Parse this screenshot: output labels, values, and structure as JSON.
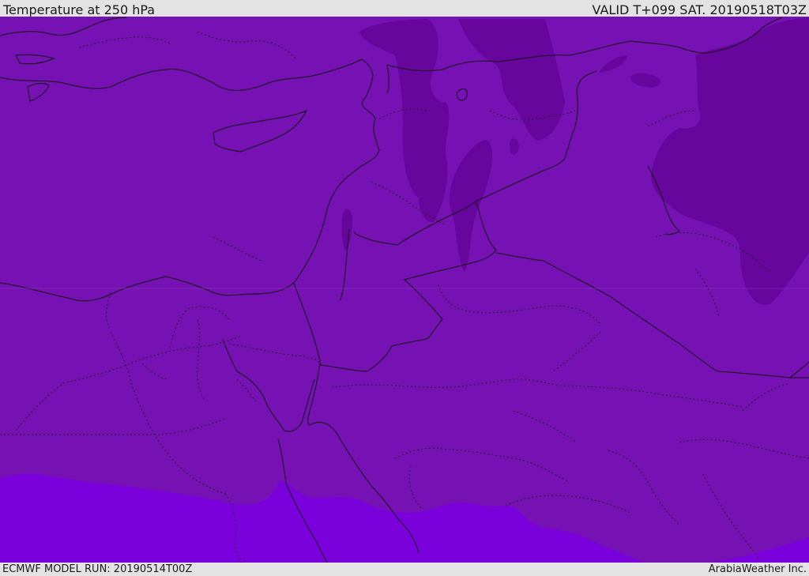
{
  "header": {
    "title": "Temperature at 250 hPa",
    "valid": "VALID T+099 SAT. 20190518T03Z"
  },
  "footer": {
    "model_run": "ECMWF MODEL RUN: 20190514T00Z",
    "credit": "ArabiaWeather Inc."
  },
  "map": {
    "field": "temperature",
    "level": "250 hPa",
    "colors": {
      "base": "#7612b4",
      "darker": "#66069c",
      "warm_band": "#7a00dc",
      "land_border": "#111111"
    }
  }
}
